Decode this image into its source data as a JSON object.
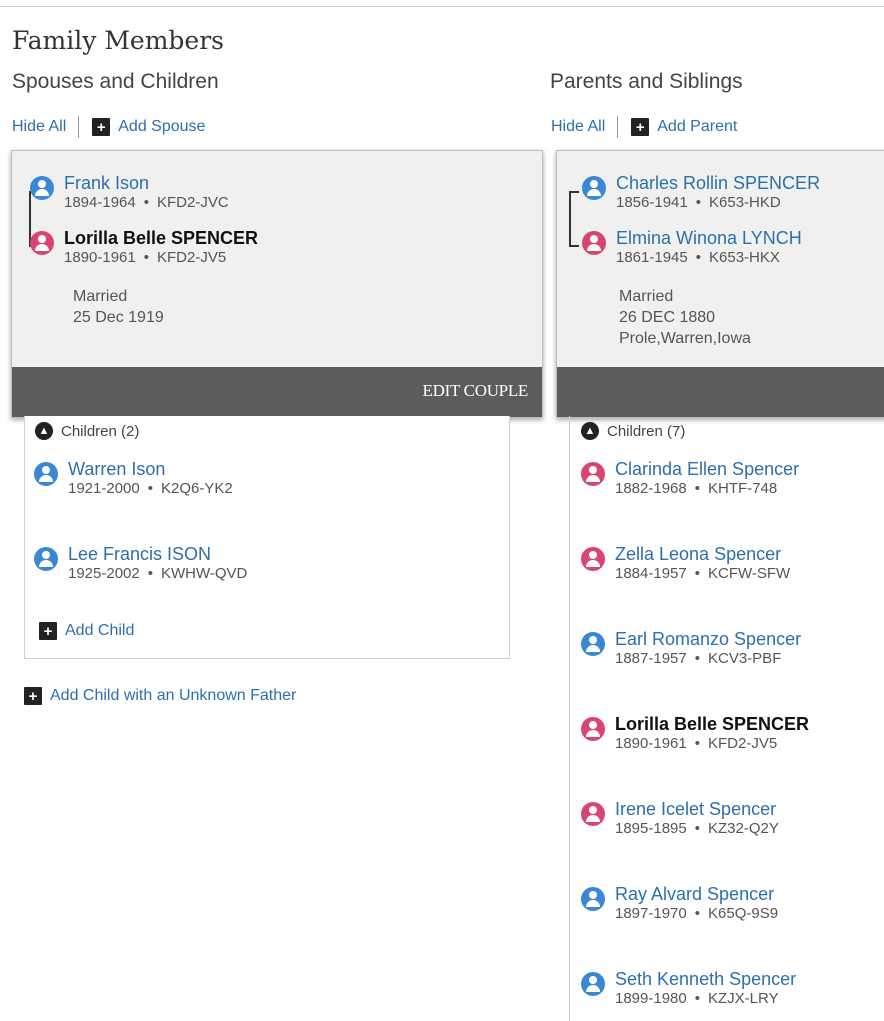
{
  "page_title": "Family Members",
  "spouses": {
    "title": "Spouses and Children",
    "hide_all": "Hide All",
    "add_spouse": "Add Spouse",
    "husband": {
      "name": "Frank Ison",
      "years": "1894-1964",
      "id": "KFD2-JVC"
    },
    "wife": {
      "name": "Lorilla Belle SPENCER",
      "years": "1890-1961",
      "id": "KFD2-JV5"
    },
    "marriage": {
      "label": "Married",
      "date": "25 Dec 1919"
    },
    "edit_couple": "EDIT COUPLE",
    "children_label": "Children",
    "children_count": "(2)",
    "children": [
      {
        "name": "Warren Ison",
        "years": "1921-2000",
        "id": "K2Q6-YK2",
        "gender": "male"
      },
      {
        "name": "Lee Francis ISON",
        "years": "1925-2002",
        "id": "KWHW-QVD",
        "gender": "male"
      }
    ],
    "add_child": "Add Child",
    "add_child_unknown": "Add Child with an Unknown Father"
  },
  "parents": {
    "title": "Parents and Siblings",
    "hide_all": "Hide All",
    "add_parent": "Add Parent",
    "father": {
      "name": "Charles Rollin SPENCER",
      "years": "1856-1941",
      "id": "K653-HKD"
    },
    "mother": {
      "name": "Elmina Winona LYNCH",
      "years": "1861-1945",
      "id": "K653-HKX"
    },
    "marriage": {
      "label": "Married",
      "date": "26 DEC 1880",
      "place": "Prole,Warren,Iowa"
    },
    "children_label": "Children",
    "children_count": "(7)",
    "children": [
      {
        "name": "Clarinda Ellen Spencer",
        "years": "1882-1968",
        "id": "KHTF-748",
        "gender": "female"
      },
      {
        "name": "Zella Leona Spencer",
        "years": "1884-1957",
        "id": "KCFW-SFW",
        "gender": "female"
      },
      {
        "name": "Earl Romanzo Spencer",
        "years": "1887-1957",
        "id": "KCV3-PBF",
        "gender": "male"
      },
      {
        "name": "Lorilla Belle SPENCER",
        "years": "1890-1961",
        "id": "KFD2-JV5",
        "gender": "female"
      },
      {
        "name": "Irene Icelet Spencer",
        "years": "1895-1895",
        "id": "KZ32-Q2Y",
        "gender": "female"
      },
      {
        "name": "Ray Alvard Spencer",
        "years": "1897-1970",
        "id": "K65Q-9S9",
        "gender": "male"
      },
      {
        "name": "Seth Kenneth Spencer",
        "years": "1899-1980",
        "id": "KZJX-LRY",
        "gender": "male"
      }
    ]
  },
  "meta_separator": "•",
  "colors": {
    "link": "#2d6fad",
    "male": "#3a87d6",
    "female": "#d74570",
    "card_bg": "#f0f0ef",
    "bar": "#5c5c5c"
  }
}
